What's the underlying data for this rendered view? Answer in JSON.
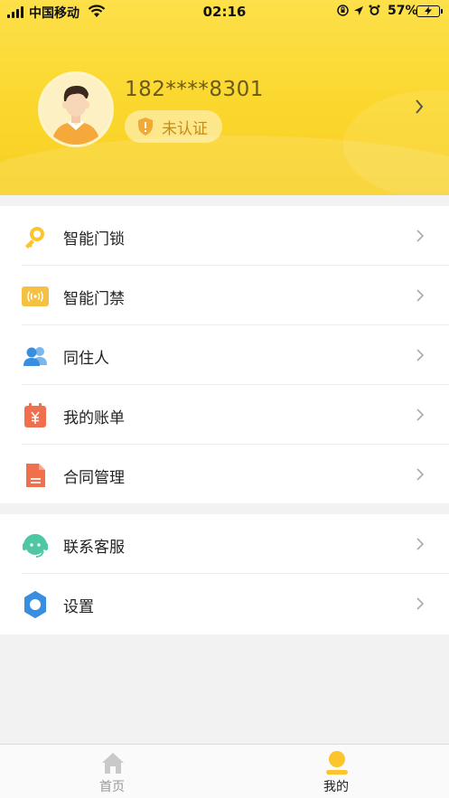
{
  "status_bar": {
    "carrier": "中国移动",
    "time": "02:16",
    "battery_percent": "57%",
    "battery_level": 0.57
  },
  "profile": {
    "phone": "182****8301",
    "verify_status": "未认证"
  },
  "menu_group_1": [
    {
      "label": "智能门锁",
      "icon": "key-icon"
    },
    {
      "label": "智能门禁",
      "icon": "access-card-icon"
    },
    {
      "label": "同住人",
      "icon": "people-icon"
    },
    {
      "label": "我的账单",
      "icon": "bill-icon"
    },
    {
      "label": "合同管理",
      "icon": "contract-icon"
    }
  ],
  "menu_group_2": [
    {
      "label": "联系客服",
      "icon": "headset-icon"
    },
    {
      "label": "设置",
      "icon": "settings-gear-icon"
    }
  ],
  "tab_bar": {
    "home": "首页",
    "mine": "我的",
    "active": "mine"
  },
  "colors": {
    "accent_yellow": "#fbd72d",
    "orange": "#f0704e",
    "blue": "#4a9be8",
    "teal": "#4fc7a5"
  }
}
